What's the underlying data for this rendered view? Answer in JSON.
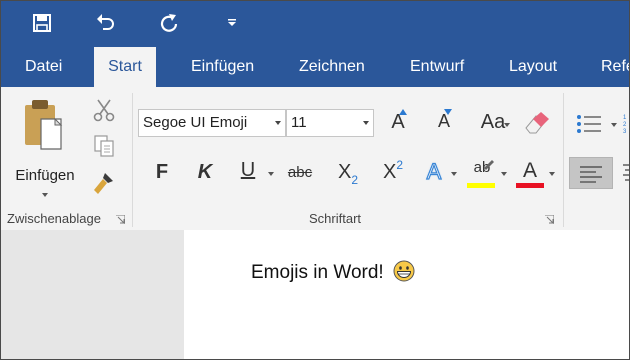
{
  "qat": {
    "save_icon": "save-icon",
    "undo_icon": "undo-icon",
    "redo_icon": "redo-icon",
    "customize_icon": "customize-qat-icon"
  },
  "tabs": [
    {
      "label": "Datei"
    },
    {
      "label": "Start",
      "active": true
    },
    {
      "label": "Einfügen"
    },
    {
      "label": "Zeichnen"
    },
    {
      "label": "Entwurf"
    },
    {
      "label": "Layout"
    },
    {
      "label": "Refe"
    }
  ],
  "ribbon": {
    "clipboard": {
      "paste_label": "Einfügen",
      "group_label": "Zwischenablage",
      "icons": [
        "paste-icon",
        "cut-icon",
        "copy-icon",
        "format-painter-icon"
      ]
    },
    "font": {
      "font_name": "Segoe UI Emoji",
      "font_size": "11",
      "group_label": "Schriftart",
      "case_label": "Aa",
      "bold_label": "F",
      "italic_label": "K",
      "underline_label": "U",
      "strike_label": "abc",
      "subscript_label": "X",
      "subscript_mark": "2",
      "superscript_label": "X",
      "superscript_mark": "2",
      "grow_label": "A",
      "shrink_label": "A",
      "effects_label": "A",
      "highlight_label": "ab",
      "fontcolor_label": "A",
      "highlight_color": "#ffff00",
      "fontcolor_color": "#e81123"
    }
  },
  "document": {
    "text": "Emojis in Word!",
    "emoji_icon": "grinning-emoji-icon"
  },
  "colors": {
    "accent": "#2b579a",
    "ribbon_bg": "#f3f3f3"
  }
}
